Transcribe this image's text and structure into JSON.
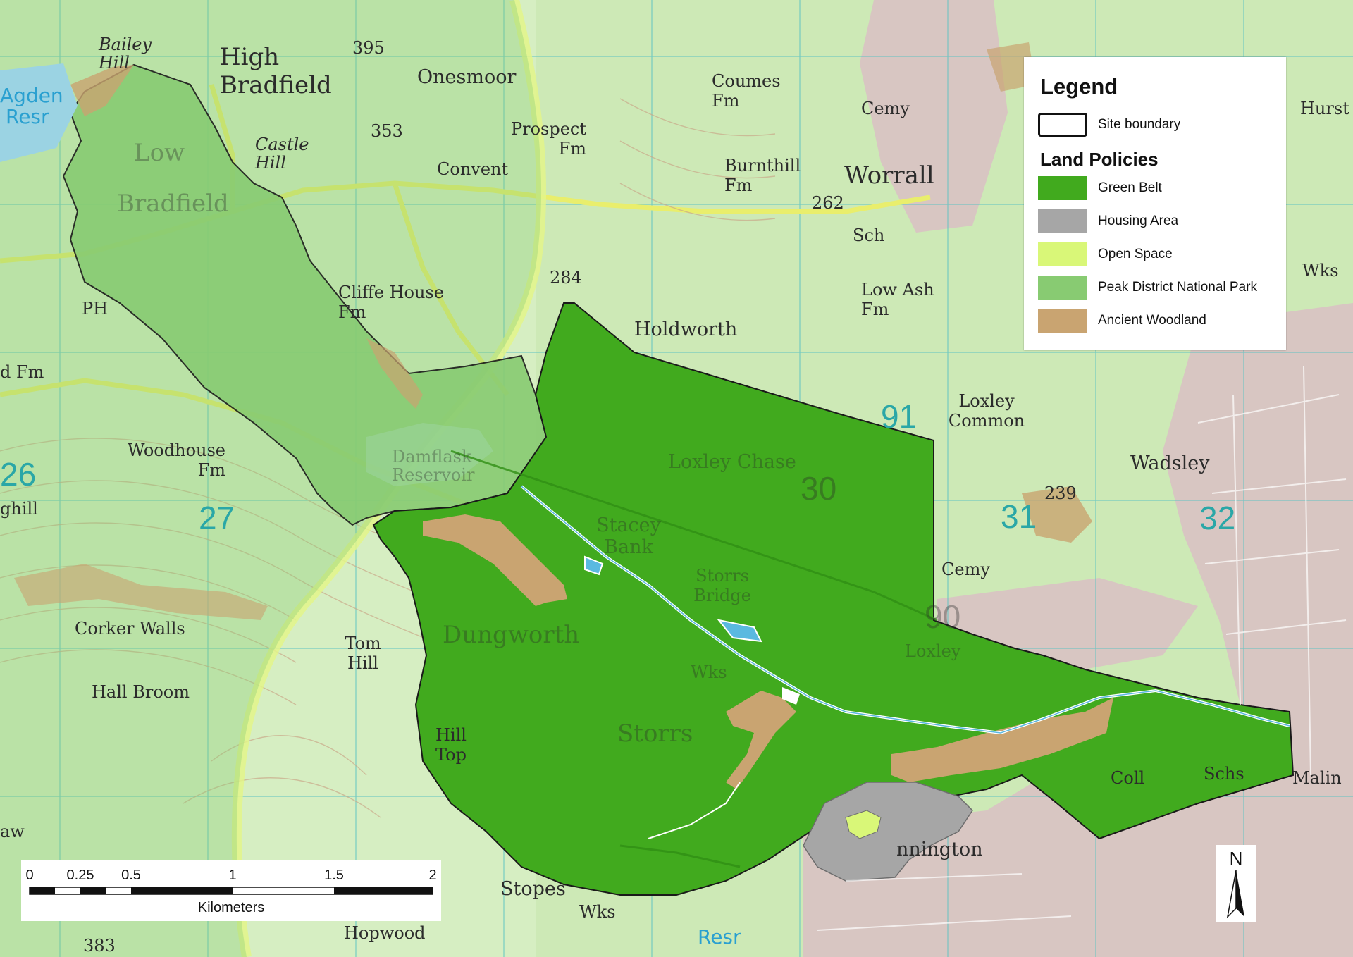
{
  "legend": {
    "title": "Legend",
    "site_boundary_label": "Site boundary",
    "land_policies_title": "Land Policies",
    "items": [
      {
        "label": "Green Belt",
        "color": "#41aa1e"
      },
      {
        "label": "Housing Area",
        "color": "#a6a6a6"
      },
      {
        "label": "Open Space",
        "color": "#d9f778"
      },
      {
        "label": "Peak District National Park",
        "color": "#88cb72"
      },
      {
        "label": "Ancient Woodland",
        "color": "#c9a471"
      }
    ]
  },
  "scale_bar": {
    "ticks": [
      "0",
      "0.25",
      "0.5",
      "1",
      "1.5",
      "2"
    ],
    "unit": "Kilometers"
  },
  "north_arrow": {
    "label": "N"
  },
  "map_labels": {
    "bailey_hill": "Bailey Hill",
    "high_bradfield_1": "High",
    "high_bradfield_2": "Bradfield",
    "onesmoor": "Onesmoor",
    "coumes_fm": "Coumes Fm",
    "cemy_top": "Cemy",
    "hurst": "Hurst",
    "agden_resr_1": "Agden",
    "agden_resr_2": "Resr",
    "castle_hill": "Castle Hill",
    "spot_353": "353",
    "spot_395": "395",
    "prospect_fm": "Prospect Fm",
    "convent": "Convent",
    "burnthill_fm": "Burnthill Fm",
    "worrall": "Worrall",
    "low_bradfield_1": "Low",
    "low_bradfield_2": "Bradfield",
    "spot_262": "262",
    "sch": "Sch",
    "wks_right": "Wks",
    "cliffe_house_fm": "Cliffe House Fm",
    "spot_284": "284",
    "low_ash_fm": "Low Ash Fm",
    "holdworth": "Holdworth",
    "ph_left": "PH",
    "ld_fm": "d Fm",
    "loxley_common": "Loxley Common",
    "woodhouse_fm": "Woodhouse Fm",
    "grid_91": "91",
    "grid_26": "26",
    "ghill": "ghill",
    "loxley_chase": "Loxley Chase",
    "wadsley": "Wadsley",
    "spot_239": "239",
    "grid_27": "27",
    "grid_30": "30",
    "grid_31": "31",
    "grid_32": "32",
    "stacey_bank": "Stacey Bank",
    "storrs_bridge": "Storrs Bridge",
    "cemy_mid": "Cemy",
    "corker_walls": "Corker Walls",
    "tom_hill": "Tom Hill",
    "dungworth": "Dungworth",
    "grid_90": "90",
    "loxley": "Loxley",
    "hall_broom": "Hall Broom",
    "wks_mid": "Wks",
    "storrs": "Storrs",
    "hill_top": "Hill Top",
    "coll": "Coll",
    "schs": "Schs",
    "malin": "Malin",
    "aw": "aw",
    "rivelin_part": "nnington",
    "stopes": "Stopes",
    "wks_bottom": "Wks",
    "hopwood": "Hopwood",
    "resr_bottom": "Resr",
    "spot_383": "383",
    "damflask_1": "Damflask",
    "damflask_2": "Reservoir"
  }
}
